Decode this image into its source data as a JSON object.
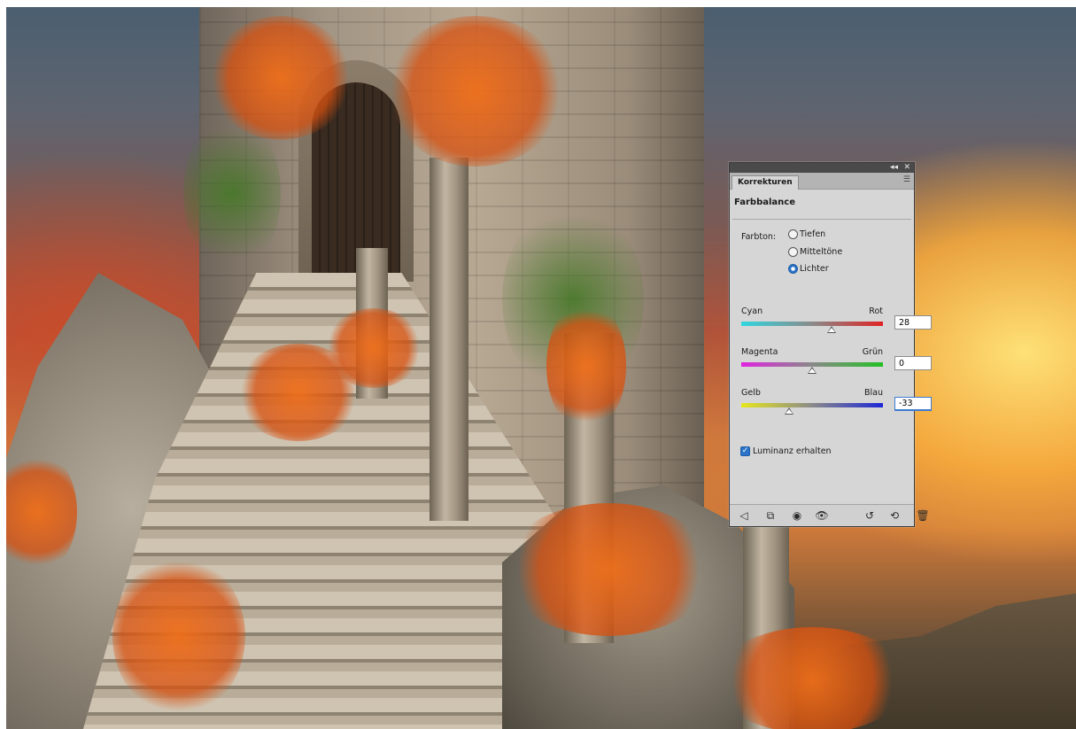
{
  "panel": {
    "window_controls": {
      "collapse": "◂◂",
      "close": "✕"
    },
    "tab_label": "Korrekturen",
    "menu_icon": "☰",
    "heading": "Farbbalance",
    "farbton": {
      "label": "Farbton:",
      "options": [
        "Tiefen",
        "Mitteltöne",
        "Lichter"
      ],
      "selected": "Lichter"
    },
    "sliders": [
      {
        "left": "Cyan",
        "right": "Rot",
        "value": "28",
        "level": 28
      },
      {
        "left": "Magenta",
        "right": "Grün",
        "value": "0",
        "level": 0
      },
      {
        "left": "Gelb",
        "right": "Blau",
        "value": "-33",
        "level": -33
      }
    ],
    "slider_range": [
      -100,
      100
    ],
    "luminance": {
      "label": "Luminanz erhalten",
      "checked": true
    },
    "toolbar_icons": [
      "back-arrow-icon",
      "clip-to-layer-icon",
      "visibility-toggle-icon",
      "view-previous-state-icon",
      "reset-icon",
      "reset-default-icon",
      "trash-icon"
    ]
  },
  "colors": {
    "panel_bg": "#d6d6d6",
    "titlebar": "#4a4a4a",
    "accent_blue": "#2a73c8"
  }
}
